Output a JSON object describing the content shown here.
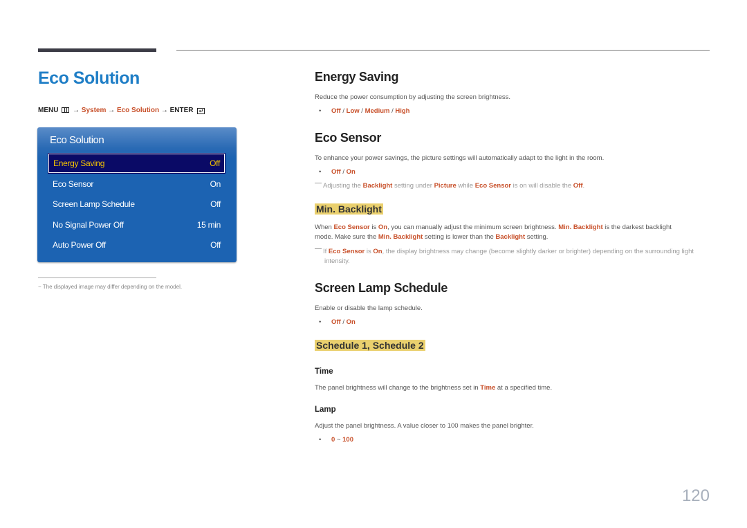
{
  "page": {
    "title": "Eco Solution",
    "page_number": "120",
    "footnote": "The displayed image may differ depending on the model."
  },
  "menu_path": {
    "menu": "MENU",
    "menu_icon": "menu-grid-icon",
    "arrow": "→",
    "system": "System",
    "eco_solution": "Eco Solution",
    "enter": "ENTER",
    "enter_icon": "enter-icon"
  },
  "osd": {
    "title": "Eco Solution",
    "colors": {
      "panel": "#1c63b2",
      "selected_bg": "#0a0a66",
      "selected_text": "#f5c400"
    },
    "items": [
      {
        "label": "Energy Saving",
        "value": "Off",
        "selected": true
      },
      {
        "label": "Eco Sensor",
        "value": "On",
        "selected": false
      },
      {
        "label": "Screen Lamp Schedule",
        "value": "Off",
        "selected": false
      },
      {
        "label": "No Signal Power Off",
        "value": "15 min",
        "selected": false
      },
      {
        "label": "Auto Power Off",
        "value": "Off",
        "selected": false
      }
    ]
  },
  "sections": {
    "energy_saving": {
      "heading": "Energy Saving",
      "description": "Reduce the power consumption by adjusting the screen brightness.",
      "options": [
        "Off",
        "Low",
        "Medium",
        "High"
      ]
    },
    "eco_sensor": {
      "heading": "Eco Sensor",
      "description": "To enhance your power savings, the picture settings will automatically adapt to the light in the room.",
      "options": [
        "Off",
        "On"
      ],
      "note": {
        "t1": "Adjusting the ",
        "b1": "Backlight",
        "t2": " setting under ",
        "b2": "Picture",
        "t3": " while ",
        "b3": "Eco Sensor",
        "t4": " is on will disable the ",
        "b4": "Off",
        "t5": "."
      }
    },
    "min_backlight": {
      "heading": "Min. Backlight",
      "line1": {
        "t1": "When ",
        "b1": "Eco Sensor",
        "t2": " is ",
        "b2": "On",
        "t3": ", you can manually adjust the minimum screen brightness. ",
        "b3": "Min. Backlight",
        "t4": " is the darkest backlight"
      },
      "line2": {
        "t1": "mode. Make sure the ",
        "b1": "Min. Backlight",
        "t2": " setting is lower than the ",
        "b2": "Backlight",
        "t3": " setting."
      },
      "note": {
        "t1": "If ",
        "b1": "Eco Sensor",
        "t2": " is ",
        "b2": "On",
        "t3": ", the display brightness may change (become slightly darker or brighter) depending on the surrounding light intensity."
      }
    },
    "screen_lamp_schedule": {
      "heading": "Screen Lamp Schedule",
      "description": "Enable or disable the lamp schedule.",
      "options": [
        "Off",
        "On"
      ]
    },
    "schedule": {
      "heading": "Schedule 1, Schedule 2",
      "time": {
        "heading": "Time",
        "t1": "The panel brightness will change to the brightness set in ",
        "b1": "Time",
        "t2": " at a specified time."
      },
      "lamp": {
        "heading": "Lamp",
        "description": "Adjust the panel brightness. A value closer to 100 makes the panel brighter.",
        "range_min": "0",
        "range_sep": "~",
        "range_max": "100"
      }
    }
  },
  "colors": {
    "title_blue": "#1f7ec6",
    "accent_orange": "#c8502a",
    "subheading_highlight": "#ead06e"
  }
}
